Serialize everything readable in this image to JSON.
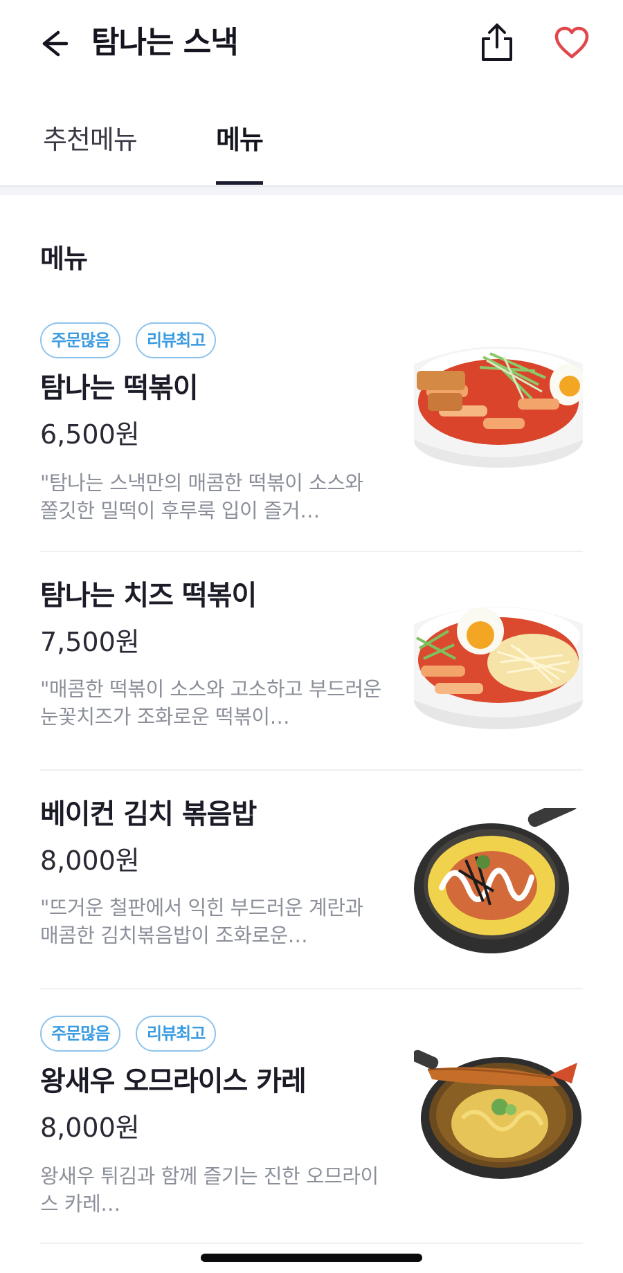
{
  "header": {
    "title": "탐나는 스낵",
    "icons": {
      "back": "arrow-left-icon",
      "share": "share-icon",
      "favorite": "heart-icon"
    },
    "favorite_color": "#e0474a"
  },
  "tabs": [
    {
      "label": "추천메뉴",
      "selected": false
    },
    {
      "label": "메뉴",
      "selected": true
    }
  ],
  "section": {
    "title": "메뉴"
  },
  "menu_items": [
    {
      "badges": [
        "주문많음",
        "리뷰최고"
      ],
      "name": "탐나는 떡볶이",
      "price": "6,500원",
      "description": "\"탐나는 스낵만의 매콤한 떡볶이 소스와 쫄깃한 밀떡이 후루룩 입이 즐거…"
    },
    {
      "badges": [],
      "name": "탐나는 치즈 떡볶이",
      "price": "7,500원",
      "description": "\"매콤한 떡볶이 소스와 고소하고 부드러운 눈꽃치즈가 조화로운 떡볶이…"
    },
    {
      "badges": [],
      "name": "베이컨 김치 볶음밥",
      "price": "8,000원",
      "description": "\"뜨거운 철판에서 익힌 부드러운 계란과 매콤한 김치볶음밥이 조화로운…"
    },
    {
      "badges": [
        "주문많음",
        "리뷰최고"
      ],
      "name": "왕새우 오므라이스 카레",
      "price": "8,000원",
      "description": "왕새우 튀김과 함께 즐기는 진한 오므라이스 카레…"
    }
  ],
  "colors": {
    "badge_text": "#3a9be0",
    "badge_border": "#8ec3ec",
    "tab_underline": "#1a1b2e",
    "desc_text": "#8b8f99"
  }
}
